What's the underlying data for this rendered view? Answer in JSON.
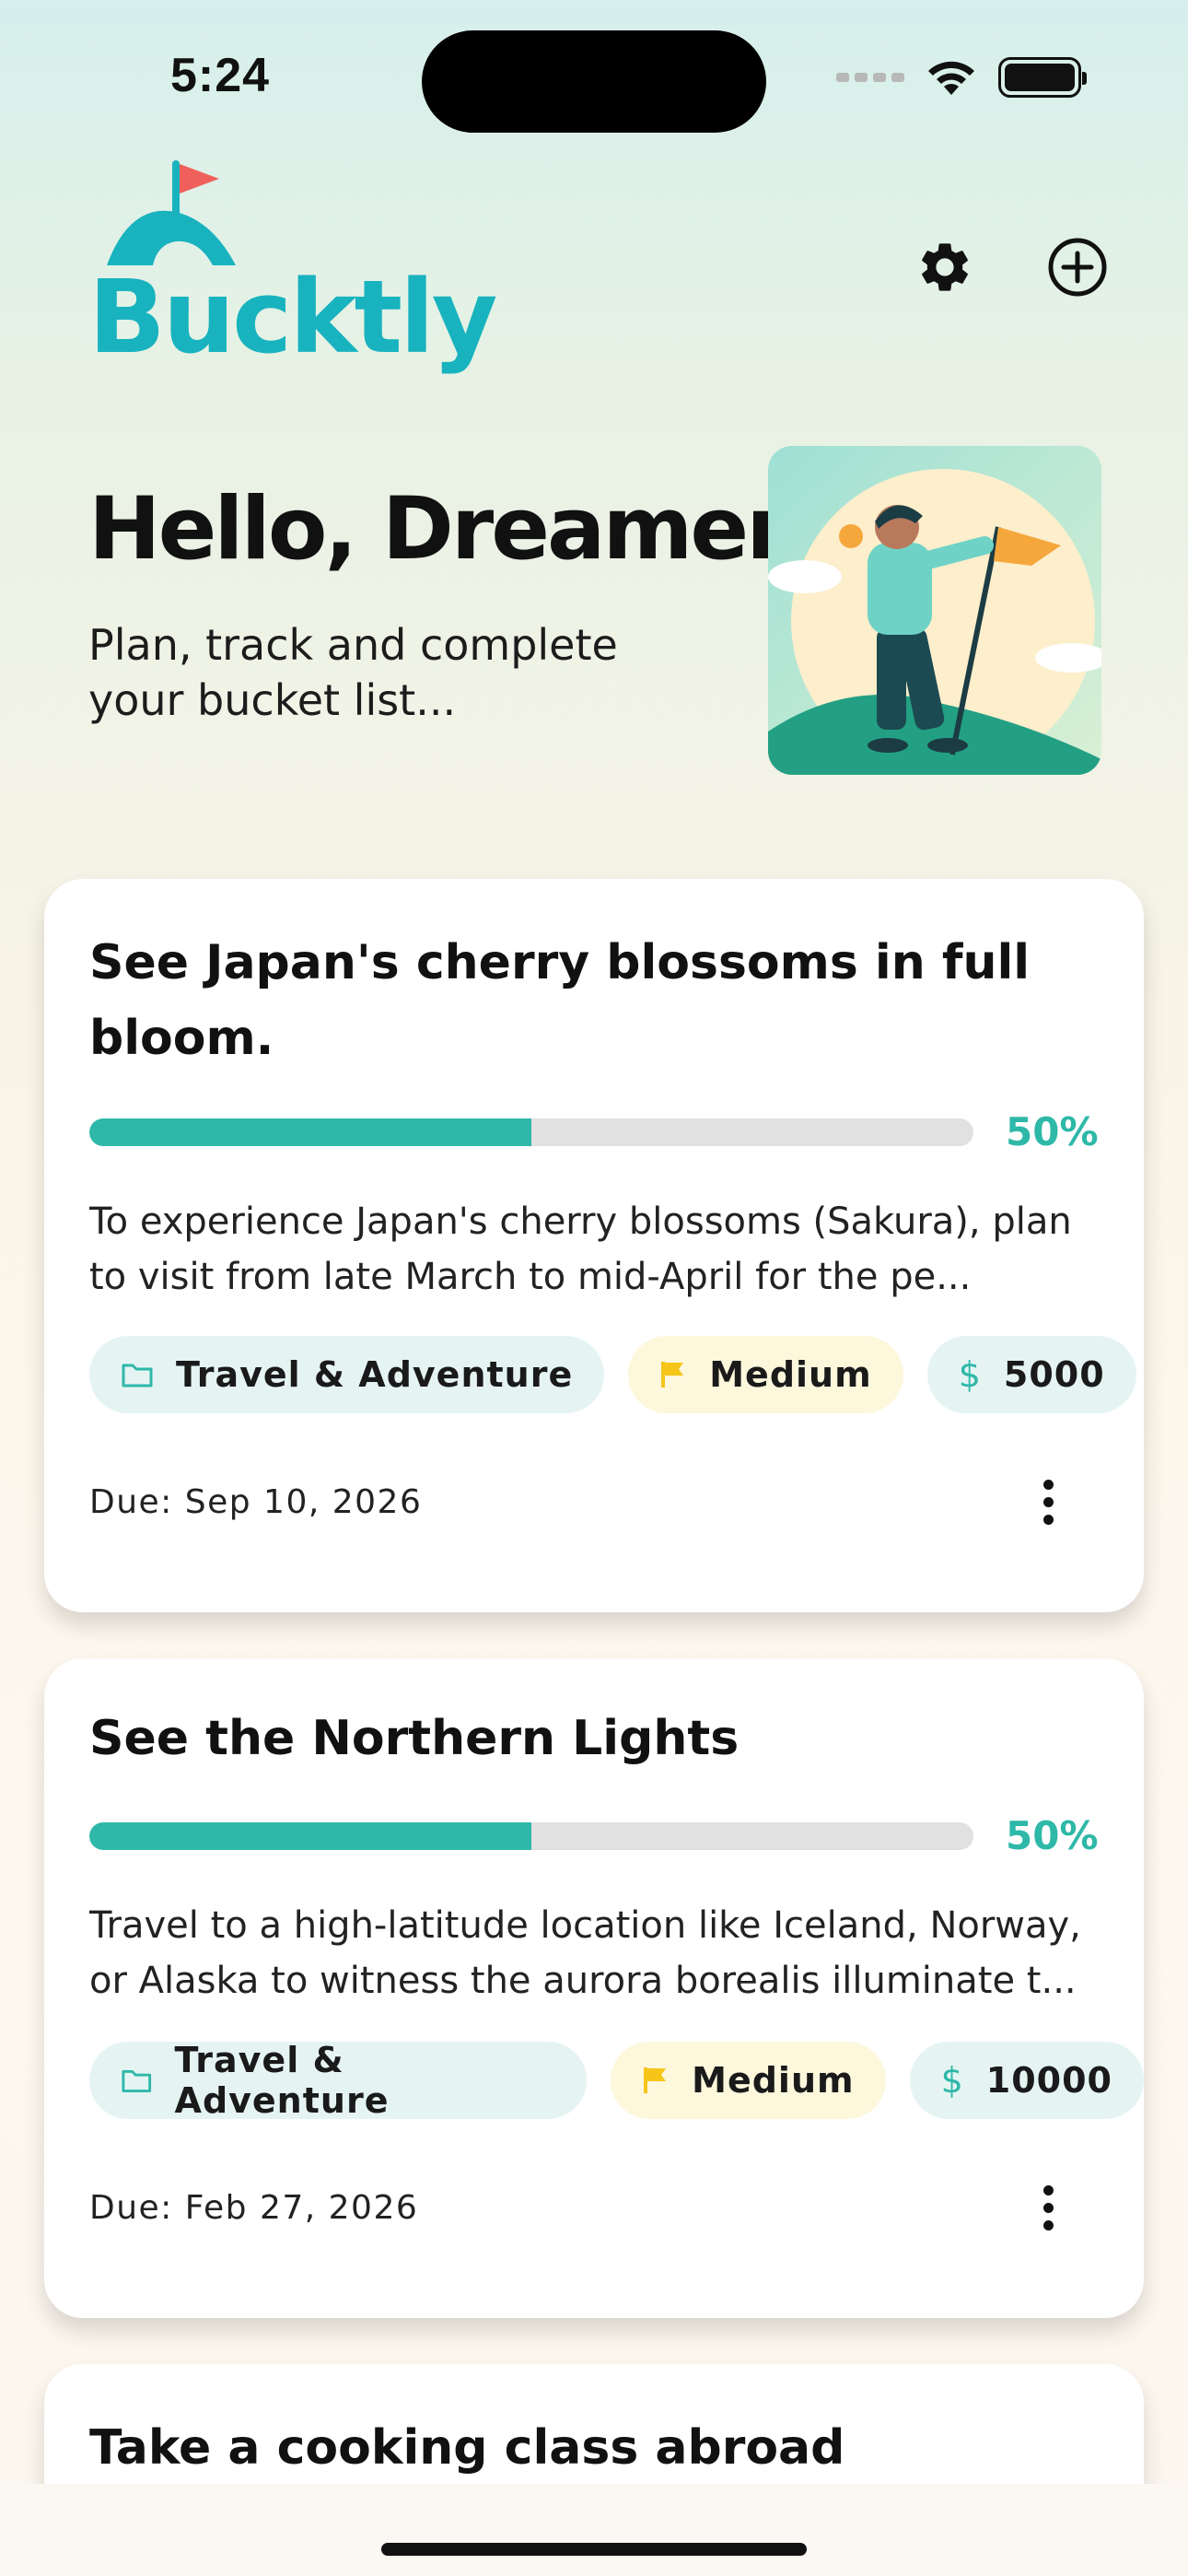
{
  "status_bar": {
    "time": "5:24"
  },
  "header": {
    "app_name": "Bucktly",
    "brand_color": "#18b3bf",
    "icons": [
      "settings-icon",
      "add-circle-icon"
    ]
  },
  "hero": {
    "greeting": "Hello, Dreamer!",
    "subtitle": "Plan, track and complete your bucket list..."
  },
  "goals": [
    {
      "title": "See Japan's cherry blossoms in full bloom.",
      "progress": 0.5,
      "progress_label": "50%",
      "description": "To experience Japan's cherry blossoms (Sakura), plan to visit from late March to mid-April for the pe...",
      "category": "Travel & Adventure",
      "priority": "Medium",
      "budget": "5000",
      "due": "Due: Sep 10, 2026"
    },
    {
      "title": "See the Northern Lights",
      "progress": 0.5,
      "progress_label": "50%",
      "description": "Travel to a high-latitude location like Iceland, Norway, or Alaska to witness the aurora borealis illuminate t...",
      "category": "Travel & Adventure",
      "priority": "Medium",
      "budget": "10000",
      "due": "Due: Feb 27, 2026"
    },
    {
      "title": "Take a cooking class abroad"
    }
  ],
  "colors": {
    "accent": "#2eb8a8",
    "priority": "#f5c518",
    "flag": "#f0605a"
  }
}
